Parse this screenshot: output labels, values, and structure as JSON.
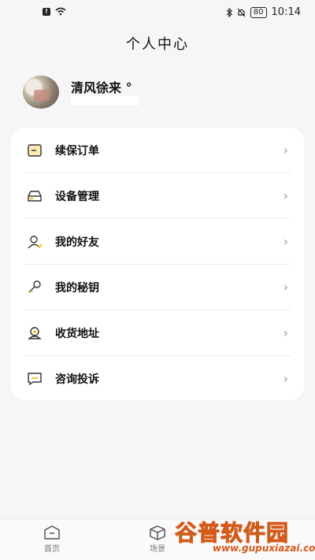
{
  "status_bar": {
    "time": "10:14",
    "battery": "80"
  },
  "header": {
    "title": "个人中心"
  },
  "profile": {
    "name": "清风徐来 °"
  },
  "menu": {
    "items": [
      {
        "label": "续保订单",
        "icon": "order-icon"
      },
      {
        "label": "设备管理",
        "icon": "device-icon"
      },
      {
        "label": "我的好友",
        "icon": "friend-icon"
      },
      {
        "label": "我的秘钥",
        "icon": "key-icon"
      },
      {
        "label": "收货地址",
        "icon": "address-icon"
      },
      {
        "label": "咨询投诉",
        "icon": "message-icon"
      }
    ],
    "chevron": "›"
  },
  "tabbar": {
    "tabs": [
      {
        "label": "首页",
        "icon": "home-icon"
      },
      {
        "label": "场景",
        "icon": "box-icon"
      }
    ]
  },
  "watermark": {
    "title": "谷普软件园",
    "url": "www.gupuxiazai.com"
  },
  "colors": {
    "background": "#f6f6f6",
    "card": "#ffffff",
    "accent": "#f5b800",
    "watermark_green": "#27a94a",
    "watermark_orange": "#d45a19"
  }
}
